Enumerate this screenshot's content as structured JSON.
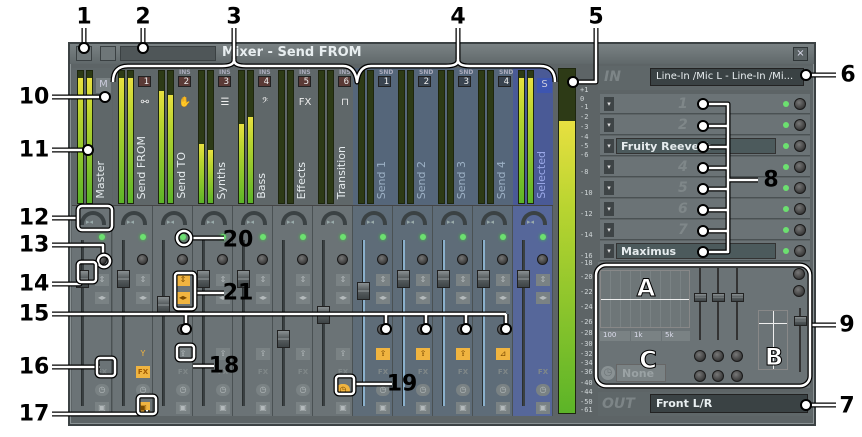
{
  "window": {
    "title": "Mixer - Send FROM",
    "close_label": "×"
  },
  "strips": [
    {
      "name": "Master",
      "type": "master",
      "badge_label": "",
      "number": "",
      "icon": "M",
      "meter": [
        0.95,
        0.95
      ],
      "volume": 0.8,
      "led": true,
      "send_knob": false,
      "route": "",
      "fx_on": false,
      "save_on": false,
      "clock_on": false
    },
    {
      "name": "Send FROM",
      "type": "ins",
      "badge_label": "",
      "number": "1",
      "icon": "⚯",
      "meter": [
        0.95,
        0.95
      ],
      "volume": 0.8,
      "led": true,
      "send_knob": false,
      "route": "Y",
      "fx_on": true,
      "save_on": true,
      "clock_on": false
    },
    {
      "name": "Send TO",
      "type": "ins",
      "badge_label": "INS",
      "number": "2",
      "icon": "✋",
      "meter": [
        0.85,
        0.82
      ],
      "volume": 0.63,
      "led": true,
      "send_knob": true,
      "route": "⇪",
      "fx_on": false,
      "save_on": false,
      "clock_on": false,
      "swap_on": true
    },
    {
      "name": "Synths",
      "type": "ins",
      "badge_label": "INS",
      "number": "3",
      "icon": "☰",
      "meter": [
        0.45,
        0.4
      ],
      "volume": 0.8,
      "led": true,
      "send_knob": false,
      "route": "⇪",
      "fx_on": false,
      "save_on": false,
      "clock_on": false
    },
    {
      "name": "Bass",
      "type": "ins",
      "badge_label": "INS",
      "number": "4",
      "icon": "𝄢",
      "meter": [
        0.6,
        0.65
      ],
      "volume": 0.8,
      "led": true,
      "send_knob": false,
      "route": "⇪",
      "fx_on": false,
      "save_on": false,
      "clock_on": false
    },
    {
      "name": "Effects",
      "type": "ins",
      "badge_label": "INS",
      "number": "5",
      "icon": "FX",
      "meter": [
        0,
        0
      ],
      "volume": 0.4,
      "led": true,
      "send_knob": false,
      "route": "⇪",
      "fx_on": false,
      "save_on": false,
      "clock_on": false
    },
    {
      "name": "Transition",
      "type": "ins",
      "badge_label": "INS",
      "number": "6",
      "icon": "⊓",
      "meter": [
        0,
        0
      ],
      "volume": 0.56,
      "led": true,
      "send_knob": false,
      "route": "⇪",
      "fx_on": false,
      "save_on": false,
      "clock_on": true
    },
    {
      "name": "Send 1",
      "type": "snd",
      "badge_label": "SND",
      "number": "1",
      "icon": "",
      "meter": [
        0,
        0
      ],
      "volume": 0.72,
      "led": true,
      "send_knob": true,
      "route": "⇪",
      "route_on": true,
      "fx_on": false,
      "save_on": false,
      "clock_on": false
    },
    {
      "name": "Send 2",
      "type": "snd",
      "badge_label": "SND",
      "number": "2",
      "icon": "",
      "meter": [
        0,
        0
      ],
      "volume": 0.8,
      "led": true,
      "send_knob": true,
      "route": "⇪",
      "route_on": true,
      "fx_on": false,
      "save_on": false,
      "clock_on": false
    },
    {
      "name": "Send 3",
      "type": "snd",
      "badge_label": "SND",
      "number": "3",
      "icon": "",
      "meter": [
        0,
        0
      ],
      "volume": 0.8,
      "led": true,
      "send_knob": true,
      "route": "⇪",
      "route_on": true,
      "fx_on": false,
      "save_on": false,
      "clock_on": false
    },
    {
      "name": "Send 4",
      "type": "snd",
      "badge_label": "SND",
      "number": "4",
      "icon": "",
      "meter": [
        0,
        0
      ],
      "volume": 0.8,
      "led": true,
      "send_knob": true,
      "route": "⊿",
      "route_on": true,
      "fx_on": false,
      "save_on": false,
      "clock_on": false
    },
    {
      "name": "Selected",
      "type": "sel",
      "badge_label": "",
      "number": "",
      "icon": "S",
      "meter": [
        0.95,
        0.95
      ],
      "volume": 0.8,
      "led": true,
      "send_knob": false,
      "route": "",
      "fx_on": false,
      "save_on": false,
      "clock_on": false
    }
  ],
  "main_meter": 0.85,
  "scale": [
    "+1",
    "0",
    "-1",
    "-2",
    "-3",
    "-4",
    "-5",
    "-6",
    "-8",
    "-10",
    "-12",
    "-14",
    "-16",
    "-18",
    "-20",
    "-22",
    "-24",
    "-26",
    "-28",
    "-30",
    "-32",
    "-34",
    "-36",
    "-40",
    "-44",
    "-50",
    "-61"
  ],
  "right_panel": {
    "in_label": "IN",
    "input": "Line-In /Mic L - Line-In /Mi...",
    "slots": [
      {
        "label": "1",
        "filled": false
      },
      {
        "label": "2",
        "filled": false
      },
      {
        "label": "Fruity Reeverb",
        "filled": true
      },
      {
        "label": "4",
        "filled": false
      },
      {
        "label": "5",
        "filled": false
      },
      {
        "label": "6",
        "filled": false
      },
      {
        "label": "7",
        "filled": false
      },
      {
        "label": "Maximus",
        "filled": true
      }
    ],
    "eq_freqs": [
      "100",
      "1k",
      "5k"
    ],
    "tempo_sync": "None",
    "out_label": "OUT",
    "output": "Front L/R"
  },
  "annotations": [
    "1",
    "2",
    "3",
    "4",
    "5",
    "6",
    "7",
    "8",
    "9",
    "10",
    "11",
    "12",
    "13",
    "14",
    "15",
    "16",
    "17",
    "18",
    "19",
    "20",
    "21",
    "A",
    "B",
    "C"
  ]
}
